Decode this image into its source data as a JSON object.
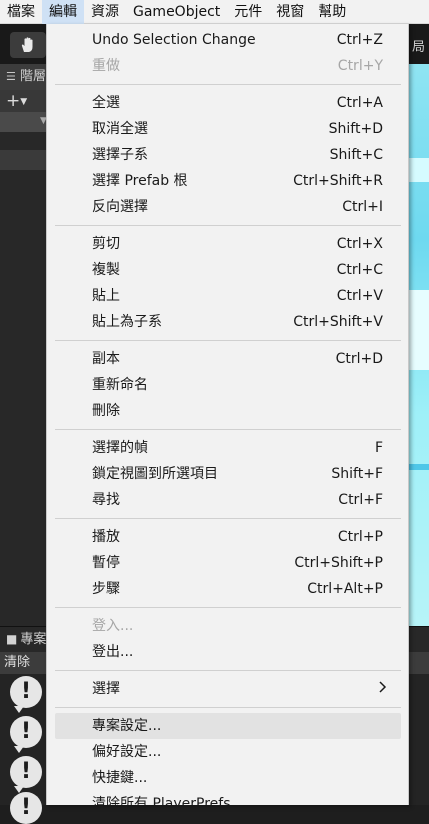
{
  "menubar": {
    "items": [
      {
        "label": "檔案",
        "active": false
      },
      {
        "label": "編輯",
        "active": true
      },
      {
        "label": "資源",
        "active": false
      },
      {
        "label": "GameObject",
        "active": false
      },
      {
        "label": "元件",
        "active": false
      },
      {
        "label": "視窗",
        "active": false
      },
      {
        "label": "幫助",
        "active": false
      }
    ]
  },
  "background": {
    "layout_label": "局",
    "hierarchy_tab": "階層",
    "project_tab": "專案",
    "console_clear": "清除",
    "scene_color": "#8fe4f2"
  },
  "edit_menu": {
    "items": [
      {
        "label": "Undo Selection Change",
        "shortcut": "Ctrl+Z"
      },
      {
        "label": "重做",
        "shortcut": "Ctrl+Y",
        "disabled": true
      },
      {
        "label": "全選",
        "shortcut": "Ctrl+A"
      },
      {
        "label": "取消全選",
        "shortcut": "Shift+D"
      },
      {
        "label": "選擇子系",
        "shortcut": "Shift+C"
      },
      {
        "label": "選擇 Prefab 根",
        "shortcut": "Ctrl+Shift+R"
      },
      {
        "label": "反向選擇",
        "shortcut": "Ctrl+I"
      },
      {
        "label": "剪切",
        "shortcut": "Ctrl+X"
      },
      {
        "label": "複製",
        "shortcut": "Ctrl+C"
      },
      {
        "label": "貼上",
        "shortcut": "Ctrl+V"
      },
      {
        "label": "貼上為子系",
        "shortcut": "Ctrl+Shift+V"
      },
      {
        "label": "副本",
        "shortcut": "Ctrl+D"
      },
      {
        "label": "重新命名",
        "shortcut": ""
      },
      {
        "label": "刪除",
        "shortcut": ""
      },
      {
        "label": "選擇的幀",
        "shortcut": "F"
      },
      {
        "label": "鎖定視圖到所選項目",
        "shortcut": "Shift+F"
      },
      {
        "label": "尋找",
        "shortcut": "Ctrl+F"
      },
      {
        "label": "播放",
        "shortcut": "Ctrl+P"
      },
      {
        "label": "暫停",
        "shortcut": "Ctrl+Shift+P"
      },
      {
        "label": "步驟",
        "shortcut": "Ctrl+Alt+P"
      },
      {
        "label": "登入...",
        "shortcut": "",
        "disabled": true
      },
      {
        "label": "登出...",
        "shortcut": ""
      },
      {
        "label": "選擇",
        "shortcut": "",
        "submenu_icon": "chevron-right-icon"
      },
      {
        "label": "專案設定...",
        "shortcut": "",
        "hover": true
      },
      {
        "label": "偏好設定...",
        "shortcut": ""
      },
      {
        "label": "快捷鍵...",
        "shortcut": ""
      },
      {
        "label": "清除所有 PlayerPrefs",
        "shortcut": ""
      }
    ]
  },
  "colors": {
    "menu_bg": "#f2f2f2",
    "menu_hover": "#e2e2e2",
    "menubar_active": "#cfe1f5",
    "disabled_text": "#a6a6a6",
    "editor_bg": "#282828"
  }
}
